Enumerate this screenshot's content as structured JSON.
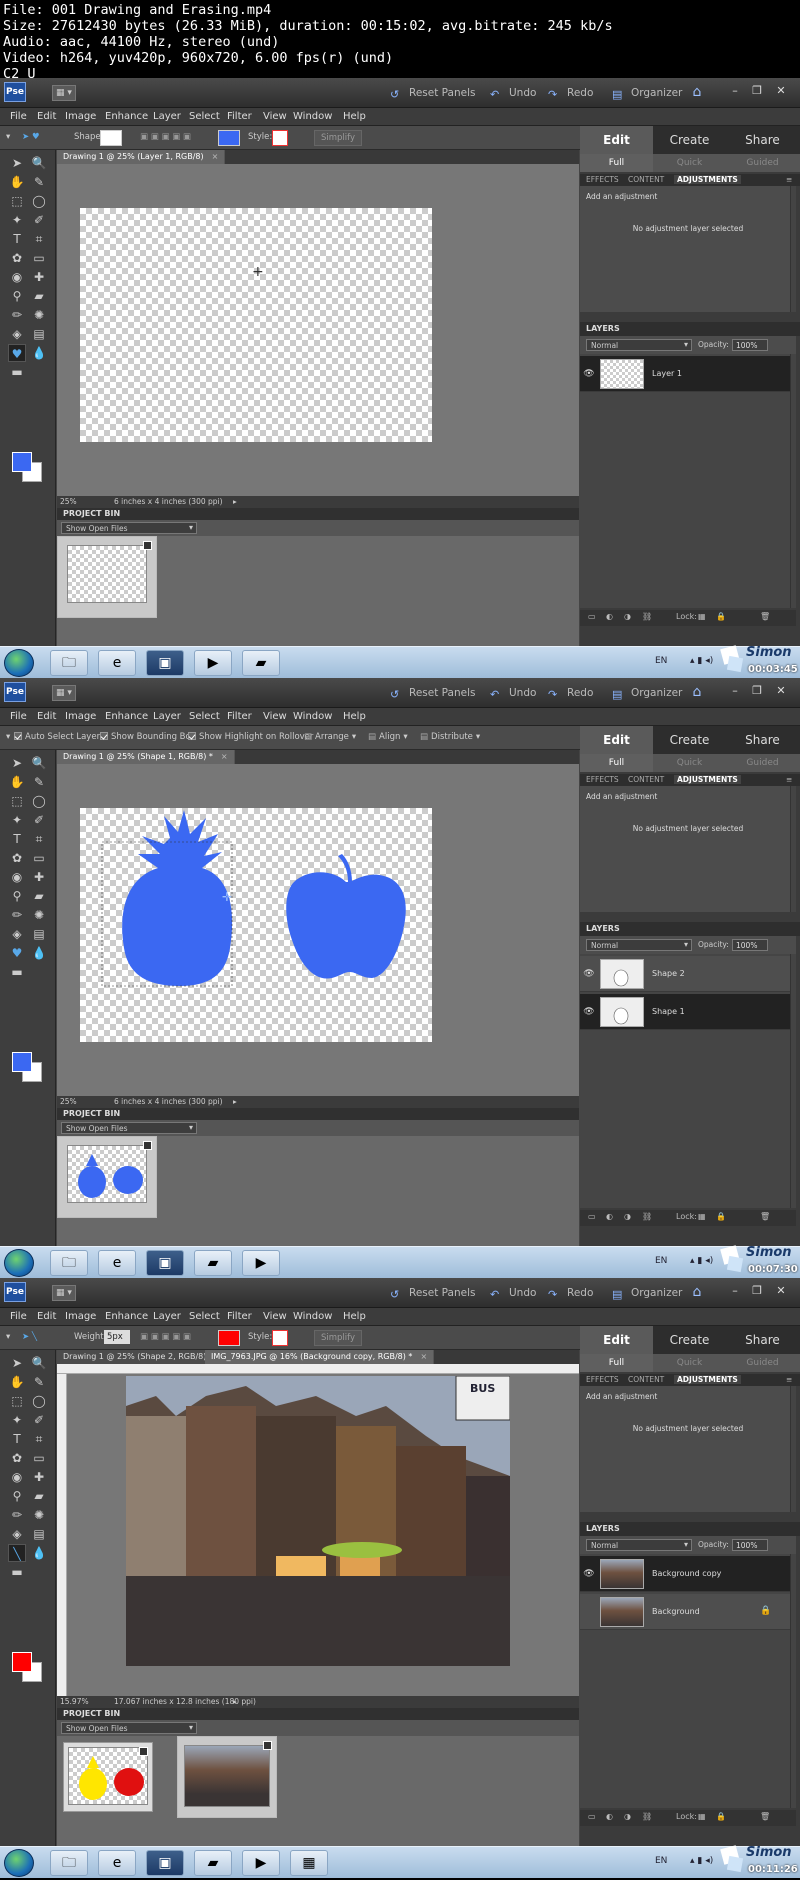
{
  "file_info": {
    "line1": "File: 001 Drawing and Erasing.mp4",
    "line2": "Size: 27612430 bytes (26.33 MiB), duration: 00:15:02, avg.bitrate: 245 kb/s",
    "line3": "Audio: aac, 44100 Hz, stereo (und)",
    "line4": "Video: h264, yuv420p, 960x720, 6.00 fps(r) (und)",
    "line5": "C2 U"
  },
  "titlebar": {
    "reset": "Reset Panels",
    "undo": "Undo",
    "redo": "Redo",
    "organizer": "Organizer"
  },
  "menu": [
    "File",
    "Edit",
    "Image",
    "Enhance",
    "Layer",
    "Select",
    "Filter",
    "View",
    "Window",
    "Help"
  ],
  "colors": {
    "accent_blue": "#3b68f2",
    "fg_red": "#ff0000"
  },
  "right_panel": {
    "modes": [
      "Edit",
      "Create",
      "Share"
    ],
    "submodes": [
      "Full",
      "Quick",
      "Guided"
    ],
    "panel_tabs": [
      "EFFECTS",
      "CONTENT",
      "ADJUSTMENTS"
    ],
    "add_adjustment": "Add an adjustment",
    "no_adjustment": "No adjustment layer selected",
    "layers_title": "LAYERS",
    "blend_mode": "Normal",
    "opacity_label": "Opacity:",
    "opacity_value": "100%",
    "lock_label": "Lock:"
  },
  "project_bin": {
    "title": "PROJECT BIN",
    "select": "Show Open Files"
  },
  "pane1": {
    "options": {
      "shape_label": "Shape:",
      "style_label": "Style:",
      "simplify": "Simplify"
    },
    "tab": "Drawing 1 @ 25% (Layer 1, RGB/8)",
    "zoom": "25%",
    "docsize": "6 inches x 4 inches (300 ppi)",
    "layers": [
      "Layer 1"
    ],
    "tray": {
      "lang": "EN",
      "time": "00:03:45"
    }
  },
  "pane2": {
    "options": {
      "auto_select": "Auto Select Layer",
      "bounding": "Show Bounding Box",
      "highlight": "Show Highlight on Rollover",
      "arrange": "Arrange",
      "align": "Align",
      "distribute": "Distribute"
    },
    "tab": "Drawing 1 @ 25% (Shape 1, RGB/8) *",
    "zoom": "25%",
    "docsize": "6 inches x 4 inches (300 ppi)",
    "layers": [
      "Shape 2",
      "Shape 1"
    ],
    "tray": {
      "lang": "EN",
      "time": "00:07:30"
    }
  },
  "pane3": {
    "options": {
      "weight_label": "Weight:",
      "weight_value": "5px",
      "style_label": "Style:",
      "simplify": "Simplify"
    },
    "tabs": [
      "Drawing 1 @ 25% (Shape 2, RGB/8) *",
      "IMG_7963.JPG @ 16% (Background copy, RGB/8) *"
    ],
    "zoom": "15.97%",
    "docsize": "17.067 inches x 12.8 inches (180 ppi)",
    "layers": [
      "Background copy",
      "Background"
    ],
    "sign_text": "BUS",
    "tray": {
      "lang": "EN",
      "time": "00:11:26"
    }
  },
  "branding": {
    "logo": "Simon"
  }
}
